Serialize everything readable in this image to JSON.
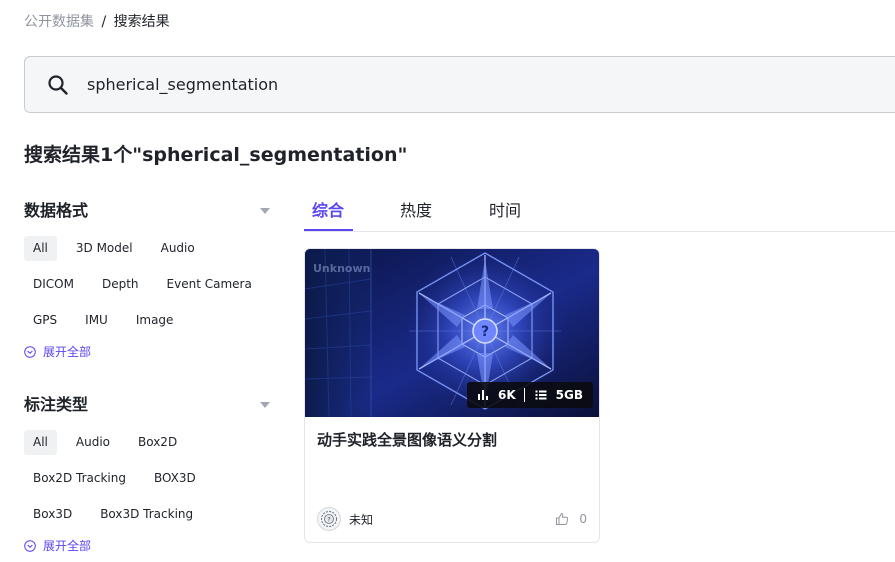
{
  "breadcrumb": {
    "parent": "公开数据集",
    "separator": "/",
    "current": "搜索结果"
  },
  "search": {
    "value": "spherical_segmentation",
    "placeholder": ""
  },
  "results_title": "搜索结果1个\"spherical_segmentation\"",
  "filters": [
    {
      "title": "数据格式",
      "rows": [
        [
          "All",
          "3D Model",
          "Audio"
        ],
        [
          "DICOM",
          "Depth",
          "Event Camera"
        ],
        [
          "GPS",
          "IMU",
          "Image"
        ]
      ],
      "expand_label": "展开全部"
    },
    {
      "title": "标注类型",
      "rows": [
        [
          "All",
          "Audio",
          "Box2D"
        ],
        [
          "Box2D Tracking",
          "BOX3D"
        ],
        [
          "Box3D",
          "Box3D Tracking"
        ]
      ],
      "expand_label": "展开全部"
    }
  ],
  "tabs": [
    "综合",
    "热度",
    "时间"
  ],
  "active_tab": 0,
  "card": {
    "watermark": "Unknown",
    "views": "6K",
    "size": "5GB",
    "title": "动手实践全景图像语义分割",
    "author": "未知",
    "likes": "0"
  },
  "colors": {
    "accent": "#5b46f0",
    "muted": "#8f959e",
    "text": "#1f2329"
  },
  "icons": {
    "search": "search-icon",
    "expand": "chevron-down-circle-icon",
    "views": "bar-chart-icon",
    "size": "list-icon",
    "like": "thumbs-up-icon"
  }
}
